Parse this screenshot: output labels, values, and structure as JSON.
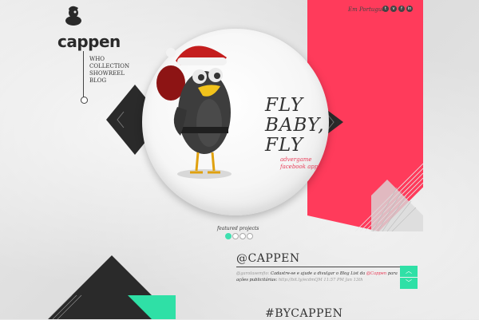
{
  "brand": {
    "name": "cappen"
  },
  "nav": {
    "items": [
      "WHO",
      "COLLECTION",
      "SHOWREEL",
      "BLOG"
    ]
  },
  "topbar": {
    "language": "Em Português",
    "social": [
      {
        "icon": "t-icon",
        "glyph": "t"
      },
      {
        "icon": "vimeo-icon",
        "glyph": "v"
      },
      {
        "icon": "facebook-icon",
        "glyph": "f"
      },
      {
        "icon": "linkedin-icon",
        "glyph": "in"
      }
    ]
  },
  "hero": {
    "title_line1": "FLY",
    "title_line2": "BABY,",
    "title_line3": "FLY",
    "subtitle1": "advergame",
    "subtitle2": "facebook app",
    "featured_label": "featured projects",
    "pager_count": 4,
    "pager_active": 0
  },
  "twitter": {
    "title": "@CAPPEN",
    "handle": "@garotasemfio:",
    "text_a": "Cadastre-se e ajude a divulgar o Blog List da",
    "mention": "@Cappen",
    "text_b": "para ações publicitárias:",
    "link": "http://bit.ly/ecdmQM",
    "time": "11:57 PM Jan 13th",
    "up_glyph": "︿",
    "down_glyph": "﹀"
  },
  "section2": {
    "title": "#BYCAPPEN"
  },
  "colors": {
    "red": "#ff3b5b",
    "green": "#2fe0a6",
    "dark": "#2a2a2a"
  }
}
